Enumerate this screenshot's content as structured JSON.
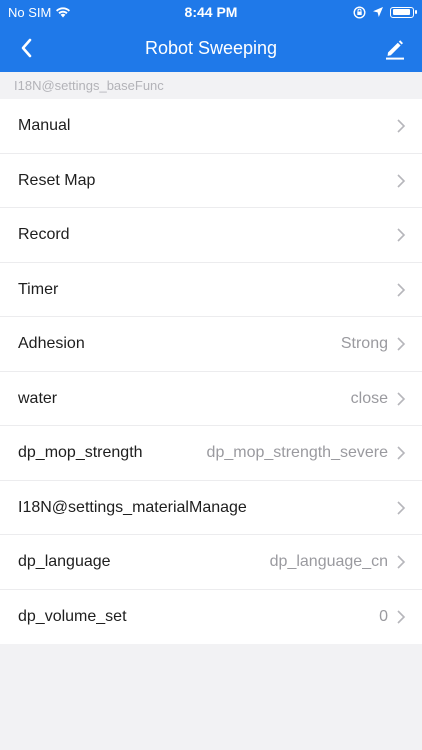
{
  "status": {
    "carrier": "No SIM",
    "time": "8:44 PM"
  },
  "nav": {
    "title": "Robot Sweeping"
  },
  "section": {
    "header": "I18N@settings_baseFunc"
  },
  "rows": [
    {
      "label": "Manual",
      "value": ""
    },
    {
      "label": "Reset Map",
      "value": ""
    },
    {
      "label": "Record",
      "value": ""
    },
    {
      "label": "Timer",
      "value": ""
    },
    {
      "label": "Adhesion",
      "value": "Strong"
    },
    {
      "label": "water",
      "value": "close"
    },
    {
      "label": "dp_mop_strength",
      "value": "dp_mop_strength_severe"
    },
    {
      "label": "I18N@settings_materialManage",
      "value": ""
    },
    {
      "label": "dp_language",
      "value": "dp_language_cn"
    },
    {
      "label": "dp_volume_set",
      "value": "0"
    }
  ],
  "colors": {
    "accent": "#1f79e9",
    "background": "#f2f2f4",
    "value_text": "#9a9a9f"
  }
}
